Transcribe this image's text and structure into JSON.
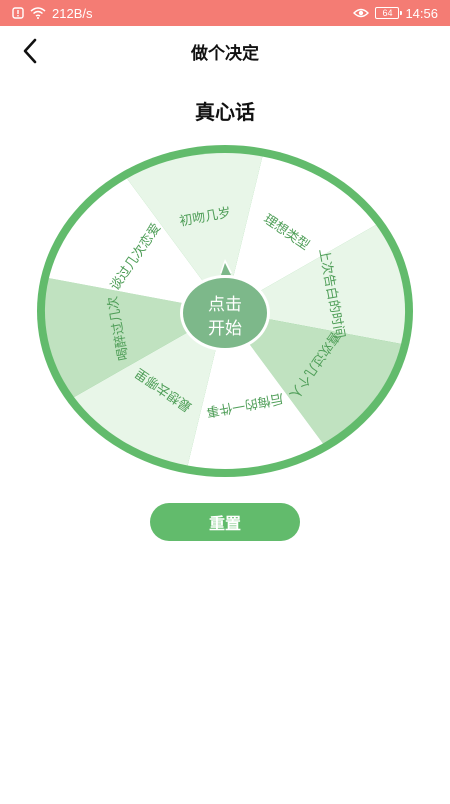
{
  "status_bar": {
    "net_speed": "212B/s",
    "battery": "64",
    "time": "14:56",
    "background": "#f47c74"
  },
  "nav": {
    "title": "做个决定",
    "back_icon": "chevron-left-icon"
  },
  "wheel": {
    "title": "真心话",
    "start_label_line1": "点击",
    "start_label_line2": "开始",
    "rim_color": "#62bb6c",
    "center_color": "#7db88a",
    "segment_colors": [
      "#ffffff",
      "#e8f6e8",
      "#c0e2c0"
    ],
    "segments": [
      "理想类型",
      "上次告白的时间",
      "喜欢过几个人",
      "后悔的一件事",
      "最想去哪里",
      "喝醉过几次",
      "谈过几次恋爱",
      "初吻几岁"
    ]
  },
  "reset": {
    "label": "重置",
    "color": "#62bb6c"
  }
}
